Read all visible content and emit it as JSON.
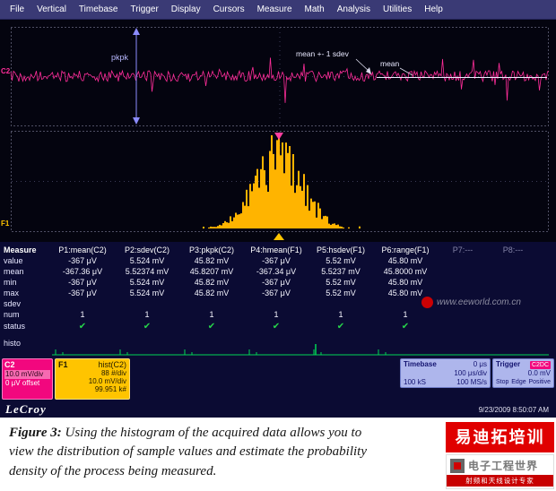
{
  "menu_bar": {
    "items": [
      "File",
      "Vertical",
      "Timebase",
      "Trigger",
      "Display",
      "Cursors",
      "Measure",
      "Math",
      "Analysis",
      "Utilities",
      "Help"
    ]
  },
  "scope": {
    "annotations": {
      "pkpk": "pkpk",
      "mean_sdev": "mean +- 1 sdev",
      "mean": "mean"
    },
    "channels": {
      "c2": "C2",
      "f1": "F1"
    }
  },
  "measure_table": {
    "corner_label": "Measure",
    "row_labels": [
      "value",
      "mean",
      "min",
      "max",
      "sdev",
      "num",
      "status",
      "histo"
    ],
    "columns": [
      {
        "header": "P1:mean(C2)",
        "cells": [
          "-367 μV",
          "-367.36 μV",
          "-367 μV",
          "-367 μV",
          "",
          "1"
        ],
        "status": "✔"
      },
      {
        "header": "P2:sdev(C2)",
        "cells": [
          "5.524 mV",
          "5.52374 mV",
          "5.524 mV",
          "5.524 mV",
          "",
          "1"
        ],
        "status": "✔"
      },
      {
        "header": "P3:pkpk(C2)",
        "cells": [
          "45.82 mV",
          "45.8207 mV",
          "45.82 mV",
          "45.82 mV",
          "",
          "1"
        ],
        "status": "✔"
      },
      {
        "header": "P4:hmean(F1)",
        "cells": [
          "-367 μV",
          "-367.34 μV",
          "-367 μV",
          "-367 μV",
          "",
          "1"
        ],
        "status": "✔"
      },
      {
        "header": "P5:hsdev(F1)",
        "cells": [
          "5.52 mV",
          "5.5237 mV",
          "5.52 mV",
          "5.52 mV",
          "",
          "1"
        ],
        "status": "✔"
      },
      {
        "header": "P6:range(F1)",
        "cells": [
          "45.80 mV",
          "45.8000 mV",
          "45.80 mV",
          "45.80 mV",
          "",
          "1"
        ],
        "status": "✔"
      },
      {
        "header": "P7:---",
        "cells": [
          "",
          "",
          "",
          "",
          "",
          ""
        ],
        "dim": true
      },
      {
        "header": "P8:---",
        "cells": [
          "",
          "",
          "",
          "",
          "",
          ""
        ],
        "dim": true
      }
    ]
  },
  "descriptors": {
    "c2": {
      "label": "C2",
      "line1": "10.0 mV/div",
      "line2": "0 μV offset"
    },
    "f1": {
      "label": "F1",
      "func": "hist(C2)",
      "line1": "88 #/div",
      "line2": "10.0 mV/div",
      "line3": "99.951 k#"
    },
    "timebase": {
      "label": "Timebase",
      "value": "0 μs",
      "line1": "100 μs/div",
      "samples": "100 kS",
      "rate": "100 MS/s"
    },
    "trigger": {
      "label": "Trigger",
      "source": "C2DC",
      "level": "0.0 mV",
      "mode": "Stop",
      "type": "Edge",
      "slope": "Positive"
    }
  },
  "footer": {
    "logo": "LeCroy",
    "datetime": "9/23/2009 8:50:07 AM"
  },
  "caption": {
    "figure_label": "Figure 3:",
    "text": "Using the histogram of the acquired data allows you to view the distribution of sample values and estimate the probability density of the process being measured."
  },
  "watermarks": {
    "eeworld": "www.eeworld.com.cn",
    "training": "易迪拓培训",
    "logo_title": "电子工程世界",
    "logo_subtitle": "射频和天线设计专家"
  },
  "colors": {
    "trace": "#ff2d9a",
    "histogram": "#ffb400",
    "check": "#26d44a",
    "histo_icons": "#00d455"
  }
}
